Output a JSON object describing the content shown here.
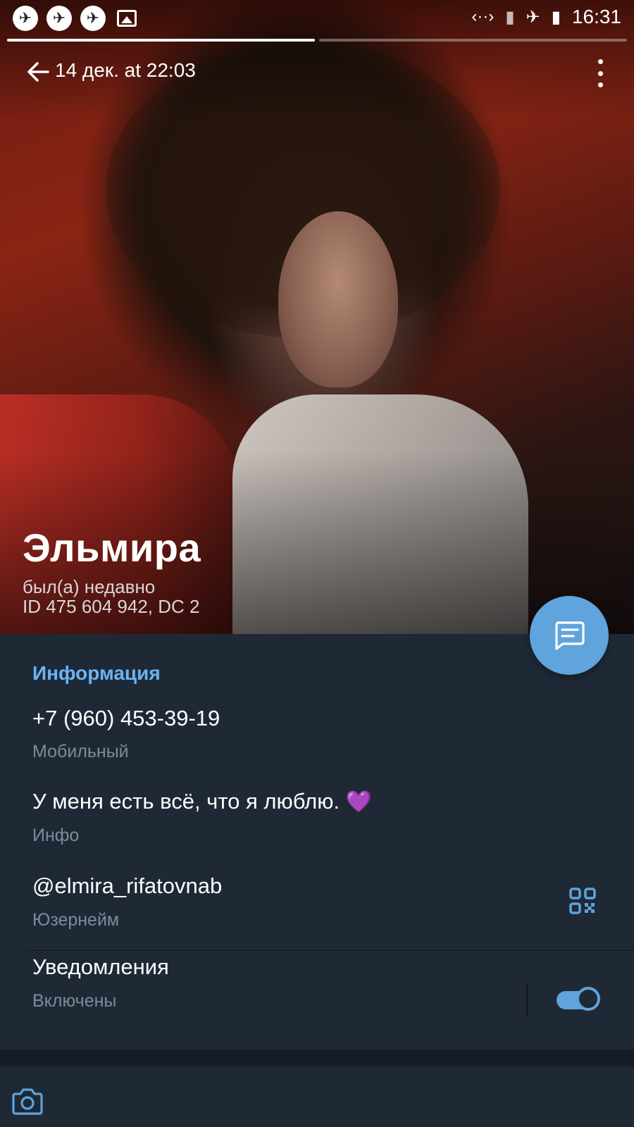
{
  "status_bar": {
    "notification_icons": [
      "app-notification-icon",
      "app-notification-icon",
      "app-notification-icon",
      "image-icon"
    ],
    "right_icons": [
      "data-arrows-icon",
      "no-sim-icon",
      "airplane-mode-icon",
      "battery-charging-icon"
    ],
    "time": "16:31"
  },
  "story": {
    "segments": 2,
    "active_segment": 1
  },
  "header": {
    "date": "14 дек. at 22:03"
  },
  "profile": {
    "name": "Эльмира",
    "last_seen": "был(а) недавно",
    "id_line": "ID 475 604 942, DC 2"
  },
  "info": {
    "section_title": "Информация",
    "phone": {
      "value": "+7 (960) 453-39-19",
      "label": "Мобильный"
    },
    "bio": {
      "value": "У меня есть всё, что я люблю.",
      "emoji": "💜",
      "label": "Инфо"
    },
    "username": {
      "value": "@elmira_rifatovnab",
      "label": "Юзернейм"
    },
    "notifications": {
      "value": "Уведомления",
      "label": "Включены",
      "enabled": true
    }
  },
  "colors": {
    "accent": "#6ab3f3",
    "fab": "#5fa4dc",
    "panel": "#1f2936",
    "label": "#7d8b99"
  }
}
